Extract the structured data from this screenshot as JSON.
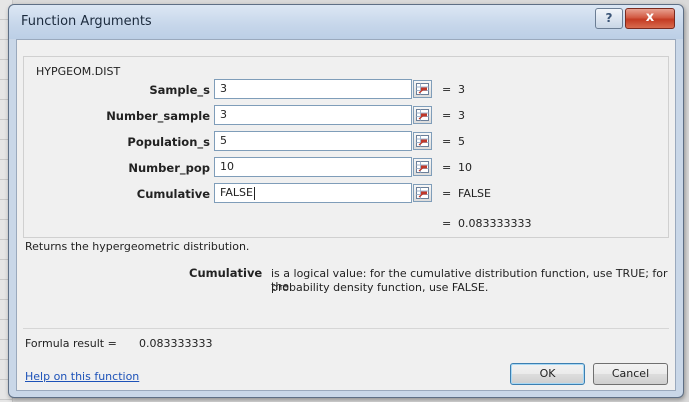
{
  "window": {
    "title": "Function Arguments",
    "help_button": "?",
    "close_button": "x"
  },
  "function": {
    "name": "HYPGEOM.DIST",
    "arguments": [
      {
        "label": "Sample_s",
        "value": "3",
        "eq": "=",
        "result": "3"
      },
      {
        "label": "Number_sample",
        "value": "3",
        "eq": "=",
        "result": "3"
      },
      {
        "label": "Population_s",
        "value": "5",
        "eq": "=",
        "result": "5"
      },
      {
        "label": "Number_pop",
        "value": "10",
        "eq": "=",
        "result": "10"
      },
      {
        "label": "Cumulative",
        "value": "FALSE",
        "eq": "=",
        "result": "FALSE"
      }
    ],
    "total_eq": "=",
    "total_result": "0.083333333",
    "description": "Returns the hypergeometric distribution.",
    "arg_desc_name": "Cumulative",
    "arg_desc_line1": "is a logical value: for the cumulative distribution function, use TRUE; for the",
    "arg_desc_line2": "probability density function, use FALSE."
  },
  "footer": {
    "formula_result_label": "Formula result =",
    "formula_result_value": "0.083333333",
    "help_link": "Help on this function",
    "ok_label": "OK",
    "cancel_label": "Cancel"
  },
  "icons": {
    "ref": "collapse-dialog-icon"
  }
}
